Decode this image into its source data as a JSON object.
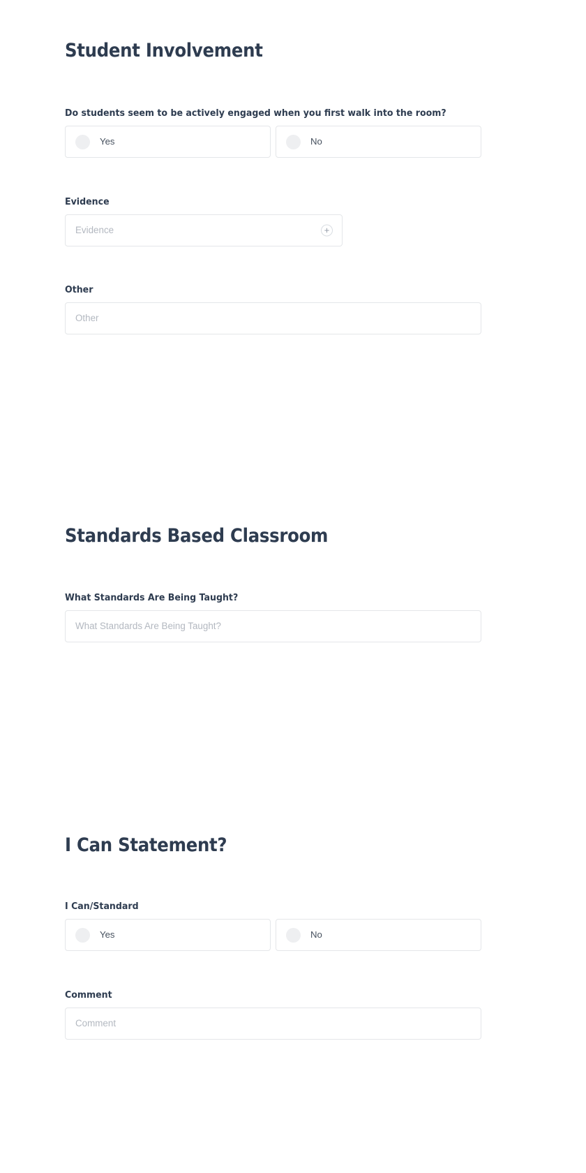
{
  "theme": {
    "background": "#ffffff",
    "heading_color": "#2e3c50",
    "label_color": "#2e3c50",
    "placeholder_color": "#b3b8c0",
    "border_color": "#e4e6e9",
    "radio_fill": "#eeeff1",
    "option_text_color": "#46505e"
  },
  "sections": [
    {
      "title": "Student Involvement",
      "fields": [
        {
          "type": "radio-group",
          "label": "Do students seem to be actively engaged when you first walk into the room?",
          "options": [
            {
              "label": "Yes",
              "selected": false
            },
            {
              "label": "No",
              "selected": false
            }
          ]
        },
        {
          "type": "text",
          "label": "Evidence",
          "placeholder": "Evidence",
          "value": "",
          "trailing_icon": "plus-circle-icon"
        },
        {
          "type": "text",
          "label": "Other",
          "placeholder": "Other",
          "value": ""
        }
      ]
    },
    {
      "title": "Standards Based Classroom",
      "fields": [
        {
          "type": "text",
          "label": "What Standards Are Being Taught?",
          "placeholder": "What Standards Are Being Taught?",
          "value": ""
        }
      ]
    },
    {
      "title": "I Can Statement?",
      "fields": [
        {
          "type": "radio-group",
          "label": "I Can/Standard",
          "options": [
            {
              "label": "Yes",
              "selected": false
            },
            {
              "label": "No",
              "selected": false
            }
          ]
        },
        {
          "type": "text",
          "label": "Comment",
          "placeholder": "Comment",
          "value": ""
        }
      ]
    }
  ]
}
